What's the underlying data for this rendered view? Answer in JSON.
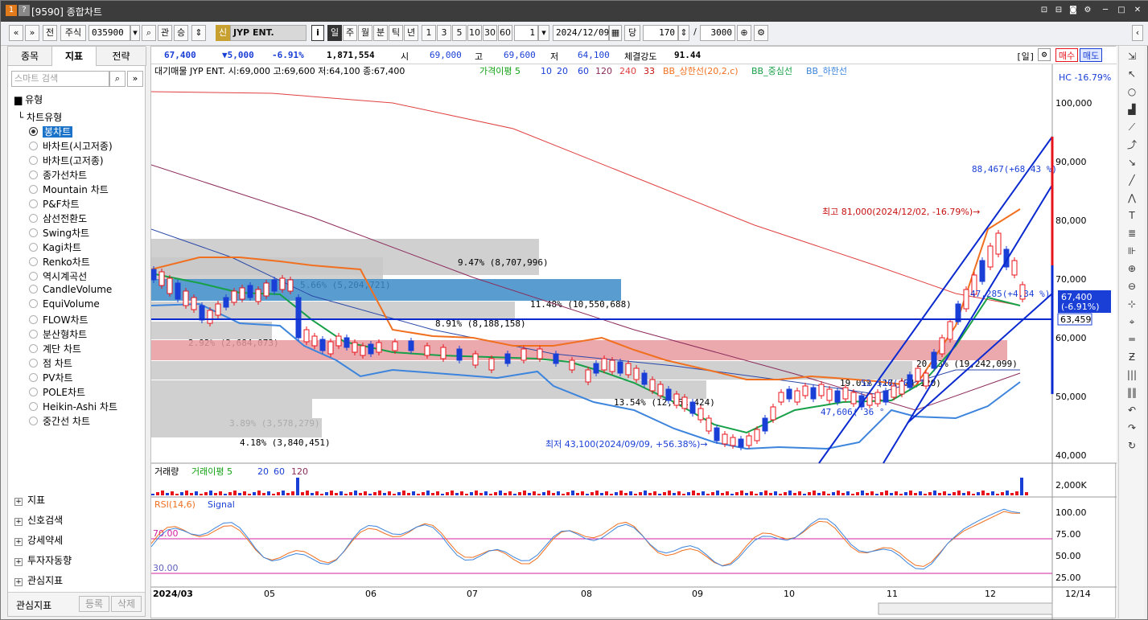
{
  "window": {
    "title": "[9590] 종합차트"
  },
  "toolbar": {
    "b1": "«",
    "b2": "»",
    "b3": "전",
    "b4": "주식",
    "code": "035900",
    "b5": "관",
    "b6": "승",
    "badge": "신",
    "name": "JYP ENT.",
    "info": "i",
    "p_day": "일",
    "p_week": "주",
    "p_month": "월",
    "p_min": "분",
    "p_tick": "틱",
    "p_year": "년",
    "n1": "1",
    "n3": "3",
    "n5": "5",
    "n10": "10",
    "n30": "30",
    "n60": "60",
    "count": "1",
    "date": "2024/12/09",
    "d_label": "당",
    "val170": "170",
    "sep": "/",
    "val3000": "3000"
  },
  "left": {
    "tabs": [
      "종목",
      "지표",
      "전략"
    ],
    "search_placeholder": "스마트 검색",
    "group": "유형",
    "subgroup": "차트유형",
    "types": [
      "봉차트",
      "바차트(시고저종)",
      "바차트(고저종)",
      "종가선차트",
      "Mountain 차트",
      "P&F차트",
      "삼선전환도",
      "Swing차트",
      "Kagi차트",
      "Renko차트",
      "역시계곡선",
      "CandleVolume",
      "EquiVolume",
      "FLOW차트",
      "분산형차트",
      "계단 차트",
      "점 차트",
      "PV차트",
      "POLE차트",
      "Heikin-Ashi 차트",
      "중간선 차트"
    ],
    "bottom": [
      "지표",
      "신호검색",
      "강세약세",
      "투자자동향",
      "관심지표"
    ],
    "fav": "관심지표",
    "reg": "등록",
    "del": "삭제"
  },
  "quote": {
    "price": "67,400",
    "change": "▼5,000",
    "pct": "-6.91%",
    "vol": "1,871,554",
    "open_l": "시",
    "open": "69,000",
    "high_l": "고",
    "high": "69,600",
    "low_l": "저",
    "low": "64,100",
    "str_l": "체결강도",
    "str": "91.44",
    "period": "[일]",
    "buy": "매수",
    "sell": "매도"
  },
  "legend": {
    "main": "대기매물 JYP ENT. 시:69,000 고:69,600 저:64,100 종:67,400",
    "ma": "가격이평 5",
    "ma10": "10",
    "ma20": "20",
    "ma60": "60",
    "ma120": "120",
    "ma240": "240",
    "ma33": "33",
    "bbu": "BB_상한선(20,2,c)",
    "bbm": "BB_중심선",
    "bbl": "BB_하한선",
    "hc": "HC -16.79%",
    "vol": "거래량",
    "volma": "거래이평 5",
    "v20": "20",
    "v60": "60",
    "v120": "120",
    "rsi": "RSI(14,6)",
    "signal": "Signal"
  },
  "annot": {
    "a1": "9.47% (8,707,996)",
    "a2": "5.66% (5,204,721)",
    "a3": "11.48% (10,550,688)",
    "a4": "8.91% (8,188,158)",
    "a5": "2.92% (2,684,073)",
    "a6": "20.93% (19,242,099)",
    "a7": "19.01% (17,474,120)",
    "a8": "13.54% (12,451,424)",
    "a9": "3.89% (3,578,279)",
    "a10": "4.18% (3,840,451)",
    "high": "최고 81,000(2024/12/02, -16.79%)→",
    "low": "최저 43,100(2024/09/09, +56.38%)→",
    "t1": "88,467(+68.43 %)",
    "t2": "47,285(+4.34 %)",
    "t3": "52,526(  61 °",
    "t4": "47,606(  36 °",
    "cur": "67,400",
    "curpct": "(-6.91%)",
    "line": "63,459"
  },
  "yaxis": [
    "100,000",
    "90,000",
    "80,000",
    "70,000",
    "60,000",
    "50,000",
    "40,000"
  ],
  "volaxis": "2,000K",
  "rsiaxis": [
    "100.00",
    "75.00",
    "50.00",
    "25.00"
  ],
  "rsi70": "70.00",
  "rsi30": "30.00",
  "xaxis": [
    "2024/03",
    "05",
    "06",
    "07",
    "08",
    "09",
    "10",
    "11",
    "12"
  ],
  "xend": "12/14",
  "colors": {
    "up": "#e8141c",
    "down": "#1a3fd6",
    "ma5": "#12a012",
    "bb": "#f07020"
  }
}
